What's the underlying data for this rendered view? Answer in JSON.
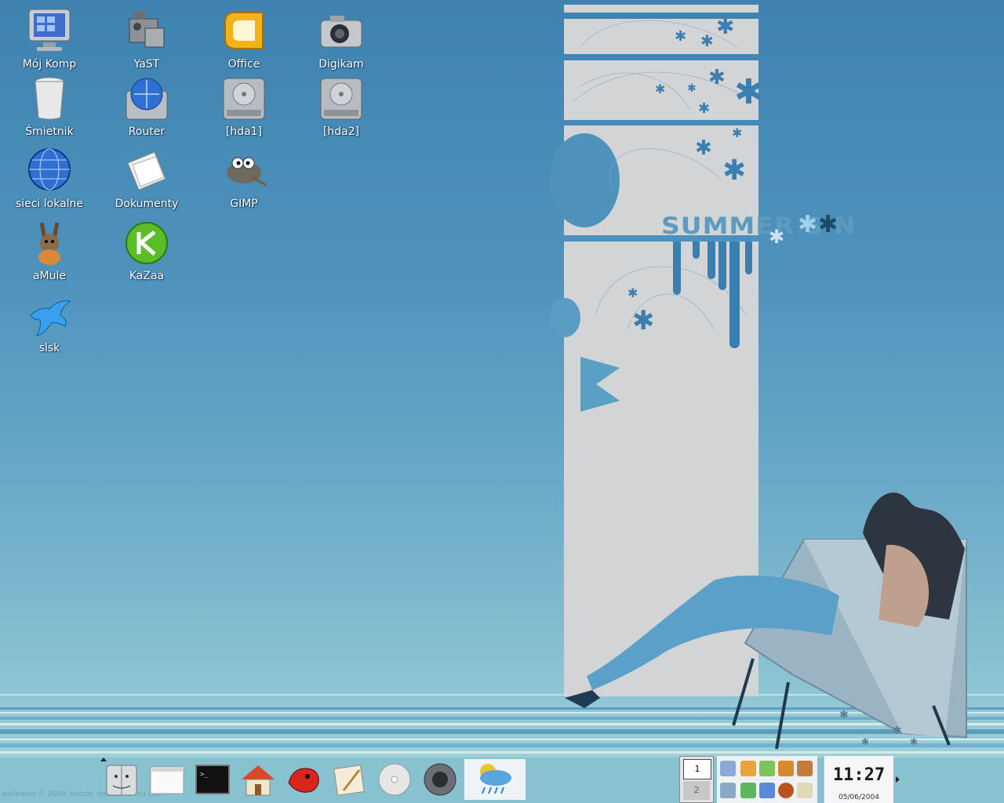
{
  "desktop": {
    "icons": [
      {
        "label": "Mój Komp",
        "icon": "computer-monitor-icon"
      },
      {
        "label": "YaST",
        "icon": "yast-icon"
      },
      {
        "label": "Office",
        "icon": "office-icon"
      },
      {
        "label": "Digikam",
        "icon": "camera-icon"
      },
      {
        "label": "Śmietnik",
        "icon": "trash-icon"
      },
      {
        "label": "Router",
        "icon": "network-drive-icon"
      },
      {
        "label": "[hda1]",
        "icon": "hard-drive-icon"
      },
      {
        "label": "[hda2]",
        "icon": "hard-drive-icon"
      },
      {
        "label": "sieci lokalne",
        "icon": "globe-icon"
      },
      {
        "label": "Dokumenty",
        "icon": "documents-icon"
      },
      {
        "label": "GIMP",
        "icon": "gimp-icon"
      },
      {
        "label": "aMule",
        "icon": "amule-icon"
      },
      {
        "label": "KaZaa",
        "icon": "kazaa-icon"
      },
      {
        "label": "slsk",
        "icon": "soulseek-icon"
      }
    ]
  },
  "wallpaper": {
    "slogan": "SUMMER S  N",
    "credit": "wallpaper © 2003, noizze, noizze.fromru.com"
  },
  "panel": {
    "launchers": [
      "finder-icon",
      "window-icon",
      "terminal-icon",
      "home-icon",
      "dragon-icon",
      "paint-icon",
      "cd-icon",
      "speaker-icon",
      "weather-icon"
    ],
    "pager": {
      "desktop1": "1",
      "desktop2": "2"
    },
    "clock": {
      "time": "11:27",
      "date": "05/06/2004"
    }
  },
  "colors": {
    "accent": "#3a7fb0",
    "band": "#d2d4d6",
    "label_text": "#ffffff"
  }
}
